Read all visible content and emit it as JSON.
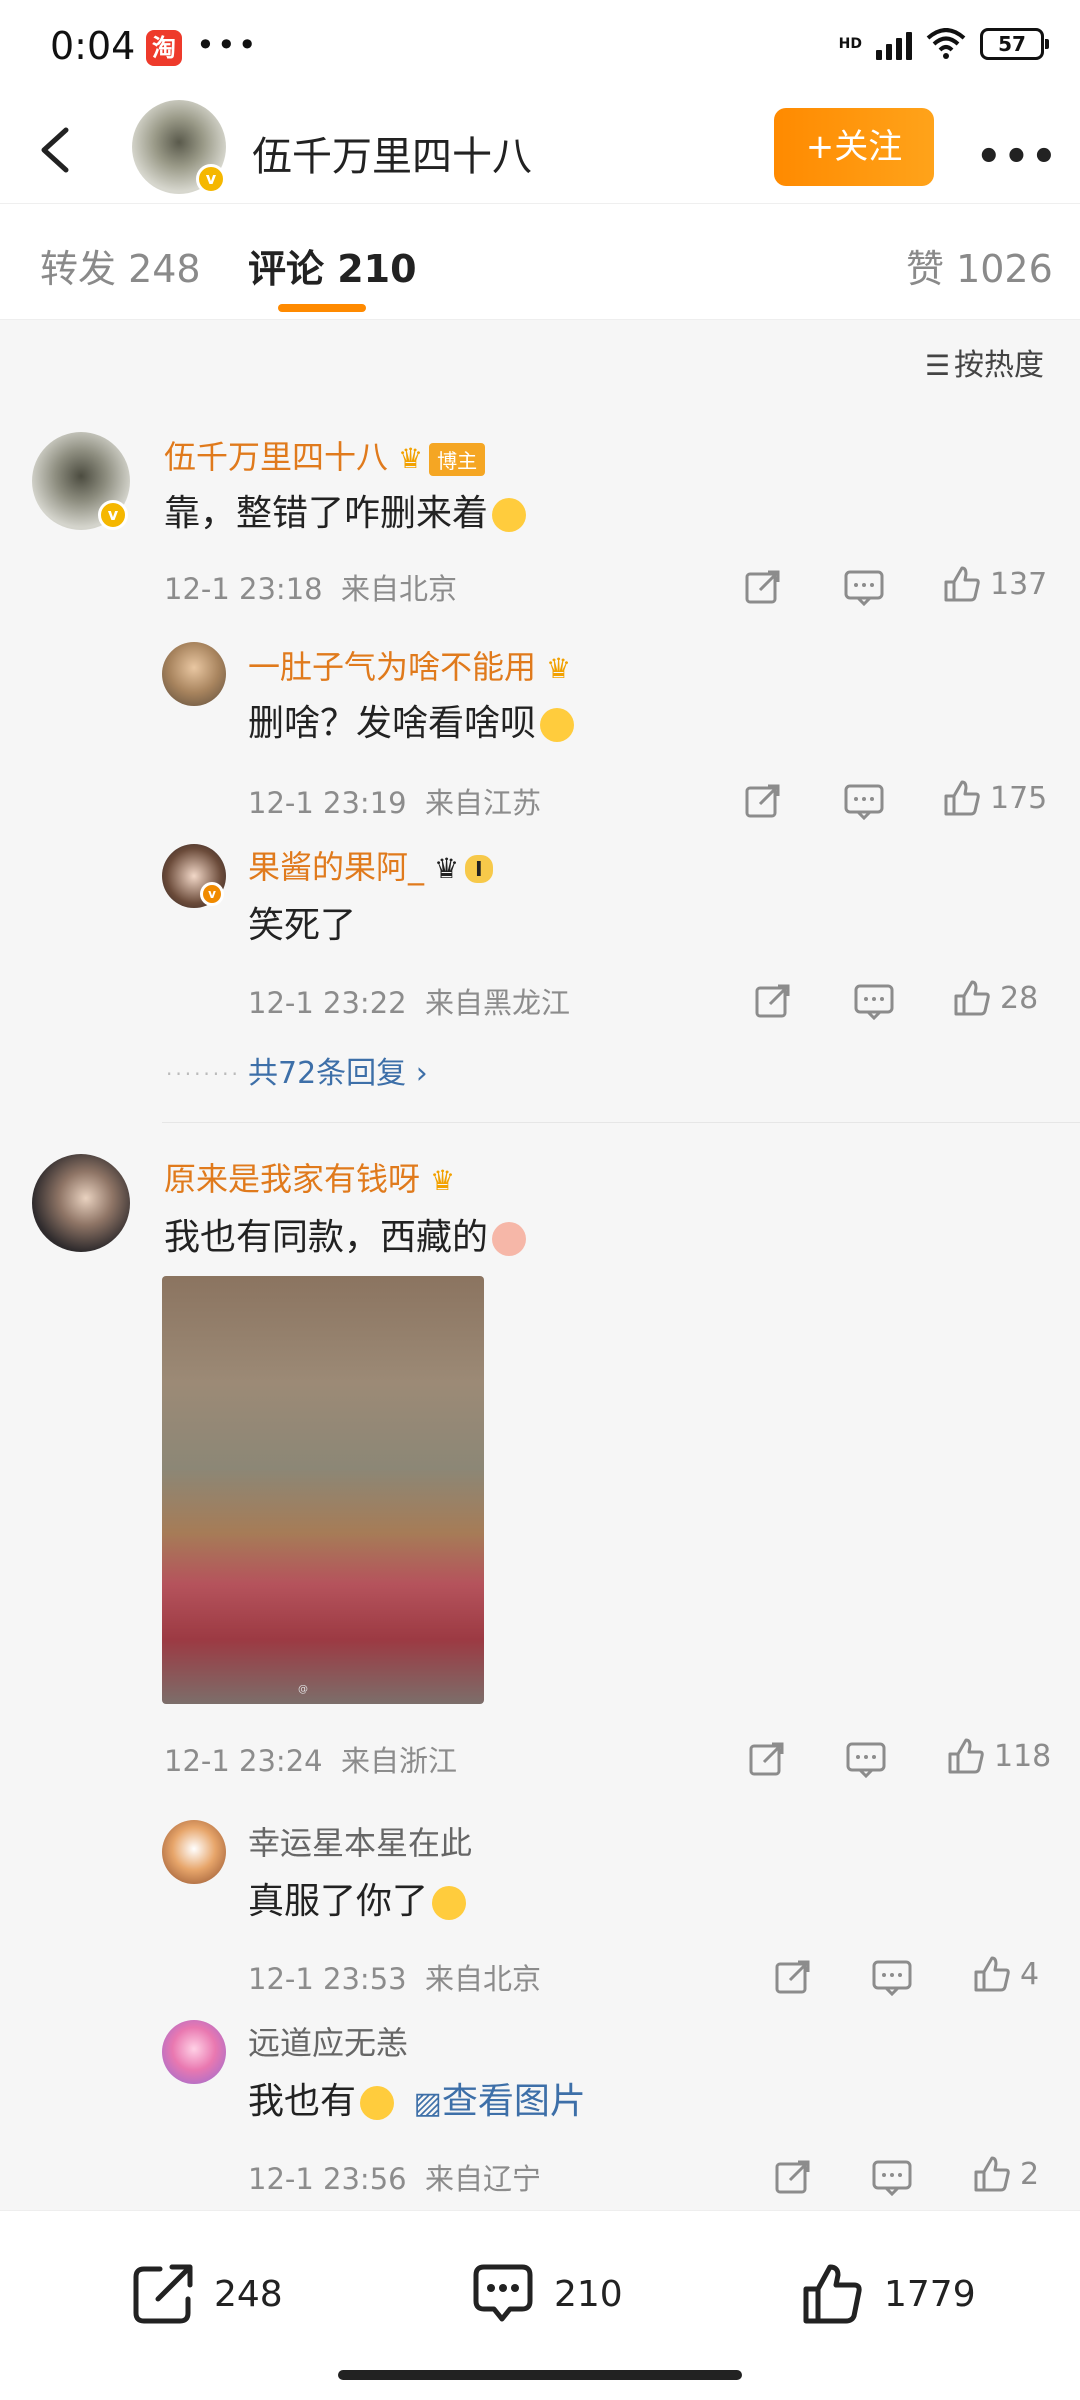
{
  "status_bar": {
    "time": "0:04",
    "app_icon": "淘",
    "dots": "•••",
    "network": "HD",
    "battery": "57"
  },
  "header": {
    "back_icon": "chevron-left-icon",
    "title": "伍千万里四十八",
    "follow_label": "+关注",
    "more": "•••"
  },
  "tabs": [
    {
      "label": "转发 248"
    },
    {
      "label": "评论 210"
    },
    {
      "label": "赞 1026"
    }
  ],
  "sort_label": "按热度",
  "comments": [
    {
      "name": "伍千万里四十八",
      "badge": "博主",
      "text": "靠，整错了咋删来着",
      "time": "12-1 23:18",
      "location": "来自北京",
      "likes": "137",
      "replies": [
        {
          "name": "一肚子气为啥不能用",
          "text": "删啥？发啥看啥呗",
          "time": "12-1 23:19",
          "location": "来自江苏",
          "likes": "175"
        },
        {
          "name": "果酱的果阿_",
          "badge": "I",
          "text": "笑死了",
          "time": "12-1 23:22",
          "location": "来自黑龙江",
          "likes": "28"
        }
      ],
      "more_replies": "共72条回复"
    },
    {
      "name": "原来是我家有钱呀",
      "text": "我也有同款，西藏的",
      "time": "12-1 23:24",
      "location": "来自浙江",
      "likes": "118",
      "replies": [
        {
          "name": "幸运星本星在此",
          "text": "真服了你了",
          "time": "12-1 23:53",
          "location": "来自北京",
          "likes": "4"
        },
        {
          "name": "远道应无恙",
          "text": "我也有",
          "link": "查看图片",
          "time": "12-1 23:56",
          "location": "来自辽宁",
          "likes": "2"
        }
      ]
    }
  ],
  "bottom_bar": {
    "repost": "248",
    "comment": "210",
    "like": "1779"
  },
  "colors": {
    "accent": "#ff8a00",
    "name": "#e07a1c",
    "link": "#3d6fa8"
  }
}
